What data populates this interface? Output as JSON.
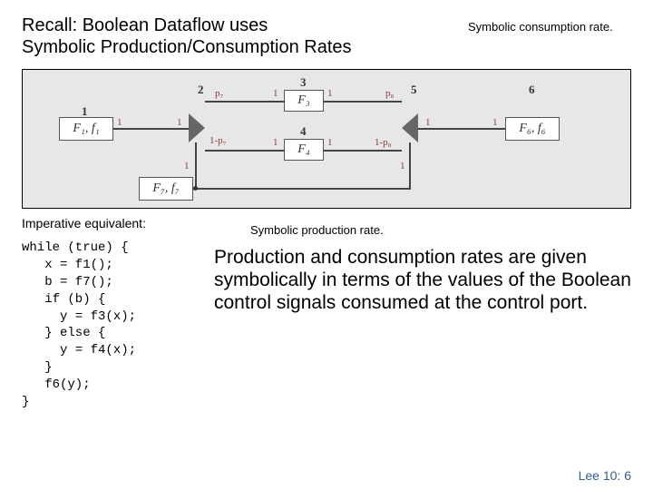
{
  "header": {
    "title_line1": "Recall: Boolean Dataflow uses",
    "title_line2": "Symbolic Production/Consumption Rates",
    "annotation_top": "Symbolic consumption rate."
  },
  "diagram": {
    "nodes": {
      "n1": "1",
      "n2": "2",
      "n3": "3",
      "n4": "4",
      "n5": "5",
      "n6": "6"
    },
    "boxes": {
      "b1": "F₁, f₁",
      "b3": "F₃",
      "b4": "F₄",
      "b6": "F₆, f₆",
      "b7": "F₇, f₇"
    },
    "rates": {
      "one": "1",
      "p7": "p₇",
      "one_minus_p7": "1-p₇",
      "p8": "p₈",
      "one_minus_p8": "1-p₈"
    }
  },
  "imperative": {
    "label": "Imperative equivalent:",
    "code": "while (true) {\n   x = f1();\n   b = f7();\n   if (b) {\n     y = f3(x);\n   } else {\n     y = f4(x);\n   }\n   f6(y);\n}"
  },
  "annotation_bottom": "Symbolic production rate.",
  "body_text": "Production and consumption rates are given symbolically in terms of the values of the Boolean control signals consumed at the control port.",
  "footer": "Lee 10: 6"
}
